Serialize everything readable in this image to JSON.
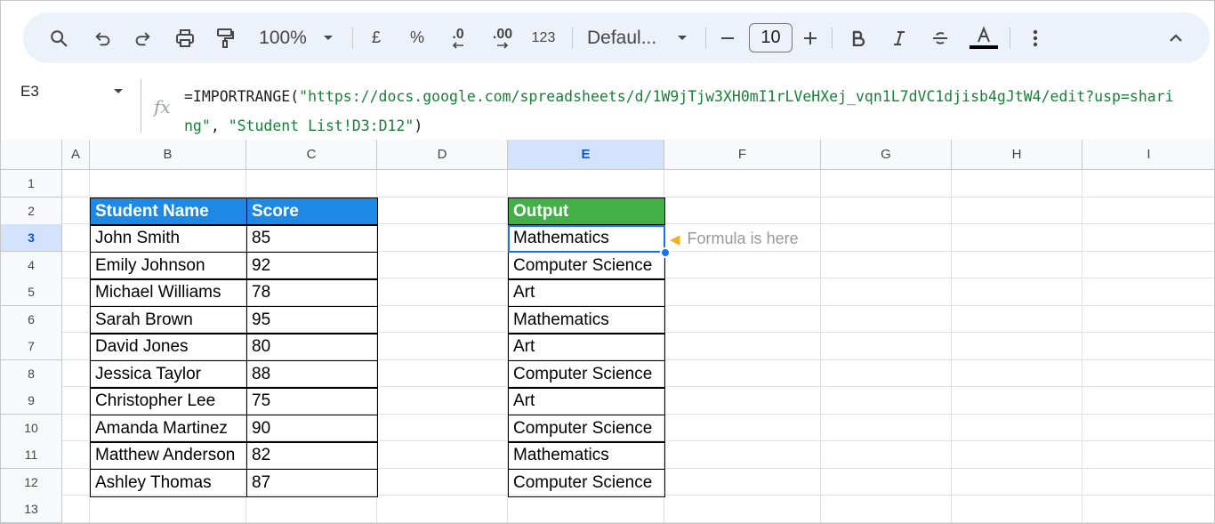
{
  "toolbar": {
    "zoom": "100%",
    "currency": "£",
    "percent": "%",
    "decrease_decimals": ".0",
    "increase_decimals": ".00",
    "number_format": "123",
    "font_name": "Defaul...",
    "font_size": "10",
    "icons": [
      "search-icon",
      "undo-icon",
      "redo-icon",
      "print-icon",
      "paint-format-icon",
      "zoom-dropdown-icon",
      "font-dropdown-icon",
      "minus-icon",
      "plus-icon",
      "bold-icon",
      "italic-icon",
      "strikethrough-icon",
      "text-color-icon",
      "more-vert-icon",
      "chevron-up-icon"
    ]
  },
  "formula_bar": {
    "cell_ref": "E3",
    "fx": "fx",
    "formula_prefix": "=IMPORTRANGE(",
    "formula_arg1": "\"https://docs.google.com/spreadsheets/d/1W9jTjw3XH0mI1rLVeHXej_vqn1L7dVC1djisb4gJtW4/edit?usp=sharing\"",
    "formula_sep": ", ",
    "formula_arg2": "\"Student List!D3:D12\"",
    "formula_suffix": ")"
  },
  "columns": [
    "A",
    "B",
    "C",
    "D",
    "E",
    "F",
    "G",
    "H",
    "I"
  ],
  "rows": [
    "1",
    "2",
    "3",
    "4",
    "5",
    "6",
    "7",
    "8",
    "9",
    "10",
    "11",
    "12",
    "13"
  ],
  "selected_column": "E",
  "selected_row": "3",
  "table_left": {
    "headers": [
      "Student Name",
      "Score"
    ],
    "rows": [
      [
        "John Smith",
        "85"
      ],
      [
        "Emily Johnson",
        "92"
      ],
      [
        "Michael Williams",
        "78"
      ],
      [
        "Sarah Brown",
        "95"
      ],
      [
        "David Jones",
        "80"
      ],
      [
        "Jessica Taylor",
        "88"
      ],
      [
        "Christopher Lee",
        "75"
      ],
      [
        "Amanda Martinez",
        "90"
      ],
      [
        "Matthew Anderson",
        "82"
      ],
      [
        "Ashley Thomas",
        "87"
      ]
    ]
  },
  "table_output": {
    "header": "Output",
    "values": [
      "Mathematics",
      "Computer Science",
      "Art",
      "Mathematics",
      "Art",
      "Computer Science",
      "Art",
      "Computer Science",
      "Mathematics",
      "Computer Science"
    ]
  },
  "annotation": {
    "icon": "pointing-hand-icon",
    "text": "Formula is here"
  },
  "colors": {
    "header_blue": "#1e88e5",
    "header_green": "#43b047",
    "selection": "#1a73e8"
  }
}
